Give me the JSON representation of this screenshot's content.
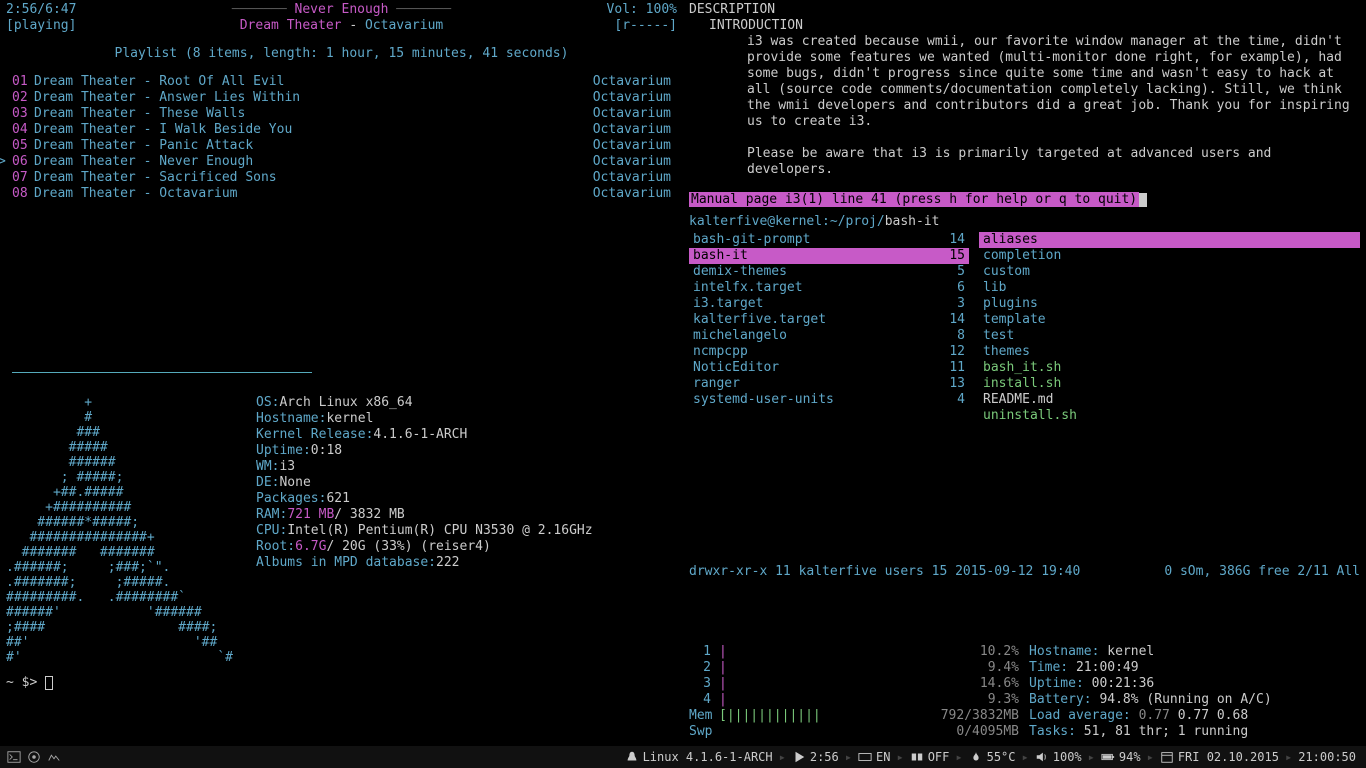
{
  "player": {
    "time": "2:56/6:47",
    "song": "Never Enough",
    "volume": "Vol: 100%",
    "status": "[playing]",
    "artist": "Dream Theater",
    "album": "Octavarium",
    "flags": "[r-----]",
    "playlist_header": "Playlist (8 items, length: 1 hour, 15 minutes, 41 seconds)",
    "tracks": [
      {
        "num": "01",
        "title": "Dream Theater - Root Of All Evil",
        "album": "Octavarium"
      },
      {
        "num": "02",
        "title": "Dream Theater - Answer Lies Within",
        "album": "Octavarium"
      },
      {
        "num": "03",
        "title": "Dream Theater - These Walls",
        "album": "Octavarium"
      },
      {
        "num": "04",
        "title": "Dream Theater - I Walk Beside You",
        "album": "Octavarium"
      },
      {
        "num": "05",
        "title": "Dream Theater - Panic Attack",
        "album": "Octavarium"
      },
      {
        "num": "06",
        "title": "Dream Theater - Never Enough",
        "album": "Octavarium"
      },
      {
        "num": "07",
        "title": "Dream Theater - Sacrificed Sons",
        "album": "Octavarium"
      },
      {
        "num": "08",
        "title": "Dream Theater - Octavarium",
        "album": "Octavarium"
      }
    ]
  },
  "archey": {
    "logo": "          +\n          #\n         ###\n        #####\n        ######\n       ; #####;\n      +##.#####\n     +##########\n    ######*#####;\n   ###############+\n  #######   #######\n.######;     ;###;`\".\n.#######;     ;#####.\n#########.   .########`\n######'           '######\n;####                 ####;\n##'                     '##\n#'                         `#",
    "info": [
      {
        "label": "OS: ",
        "val": "Arch Linux x86_64"
      },
      {
        "label": "Hostname: ",
        "val": "kernel"
      },
      {
        "label": "Kernel Release: ",
        "val": "4.1.6-1-ARCH"
      },
      {
        "label": "Uptime: ",
        "val": "0:18"
      },
      {
        "label": "WM: ",
        "val": "i3"
      },
      {
        "label": "DE: ",
        "val": "None"
      },
      {
        "label": "Packages: ",
        "val": "621"
      },
      {
        "label": "RAM: ",
        "val": "721 MB",
        "suffix": " / 3832 MB",
        "magenta": true
      },
      {
        "label": "CPU: ",
        "val": "Intel(R) Pentium(R) CPU  N3530  @ 2.16GHz"
      },
      {
        "label": "",
        "val": ""
      },
      {
        "label": "Root: ",
        "val": "6.7G",
        "suffix": " / 20G (33%) (reiser4)",
        "magenta": true
      },
      {
        "label": "Albums in MPD database: ",
        "val": "222"
      }
    ],
    "prompt": "~ $> "
  },
  "man": {
    "h1": "DESCRIPTION",
    "h2": "INTRODUCTION",
    "p1": "i3 was created because wmii, our favorite window manager at the time, didn't provide some features we wanted (multi-monitor done right, for example), had some bugs, didn't progress since quite some time and wasn't easy to hack at all (source code comments/documentation completely lacking). Still, we think the wmii developers and contributors did a great job. Thank you for inspiring us to create i3.",
    "p2": "Please be aware that i3 is primarily targeted at advanced users and developers.",
    "status": " Manual page i3(1) line 41 (press h for help or q to quit)"
  },
  "ranger": {
    "user": "kalterfive@kernel:",
    "path": "~/proj/",
    "last": "bash-it",
    "left": [
      {
        "name": " bash-git-prompt",
        "count": "14"
      },
      {
        "name": " bash-it",
        "count": "15",
        "sel": true
      },
      {
        "name": " demix-themes",
        "count": "5"
      },
      {
        "name": " intelfx.target",
        "count": "6"
      },
      {
        "name": " i3.target",
        "count": "3"
      },
      {
        "name": " kalterfive.target",
        "count": "14"
      },
      {
        "name": " michelangelo",
        "count": "8"
      },
      {
        "name": " ncmpcpp",
        "count": "12"
      },
      {
        "name": " NoticEditor",
        "count": "11"
      },
      {
        "name": " ranger",
        "count": "13"
      },
      {
        "name": " systemd-user-units",
        "count": "4"
      }
    ],
    "right": [
      {
        "name": " aliases",
        "sel": true
      },
      {
        "name": " completion"
      },
      {
        "name": " custom"
      },
      {
        "name": " lib"
      },
      {
        "name": " plugins"
      },
      {
        "name": " template"
      },
      {
        "name": " test"
      },
      {
        "name": " themes"
      },
      {
        "name": " bash_it.sh",
        "green": true
      },
      {
        "name": " install.sh",
        "green": true
      },
      {
        "name": " README.md",
        "white": true
      },
      {
        "name": " uninstall.sh",
        "green": true
      }
    ],
    "status_left": "drwxr-xr-x 11 kalterfive users 15 2015-09-12 19:40",
    "status_right": "0 sOm, 386G free  2/11  All"
  },
  "htop": {
    "cpus": [
      {
        "n": "1",
        "bar": "[||||",
        "spaces": "                           ",
        "pct": "10.2%",
        "close": "]"
      },
      {
        "n": "2",
        "bar": "[||||",
        "spaces": "                            ",
        "pct": "9.4%",
        "close": "]"
      },
      {
        "n": "3",
        "bar": "[|||||",
        "spaces": "                          ",
        "pct": "14.6%",
        "close": "]"
      },
      {
        "n": "4",
        "bar": "[|||",
        "spaces": "                             ",
        "pct": "9.3%",
        "close": "]"
      }
    ],
    "mem": {
      "label": "Mem",
      "bar": "[||||||||||||",
      "val": "792/3832MB",
      "close": "]"
    },
    "swp": {
      "label": "Swp",
      "bar": "[",
      "val": "0/4095MB",
      "close": "]"
    },
    "info": [
      {
        "label": "Hostname: ",
        "val": "kernel"
      },
      {
        "label": "Time: ",
        "val": "21:00:49"
      },
      {
        "label": "Uptime: ",
        "val": "00:21:36"
      },
      {
        "label": "Battery: ",
        "val": "94.8% (Running on A/C)"
      },
      {
        "label": "Load average: ",
        "val": "0.77 ",
        "val2": "0.77 0.68"
      },
      {
        "label": "Tasks: ",
        "val": "51, 81 thr; 1 running"
      }
    ]
  },
  "bar": {
    "kernel": "Linux 4.1.6-1-ARCH",
    "time": "2:56",
    "lang": "EN",
    "caps": "OFF",
    "temp": "55°C",
    "vol": "100%",
    "bat": "94%",
    "date": "FRI 02.10.2015",
    "clock": "21:00:50"
  }
}
